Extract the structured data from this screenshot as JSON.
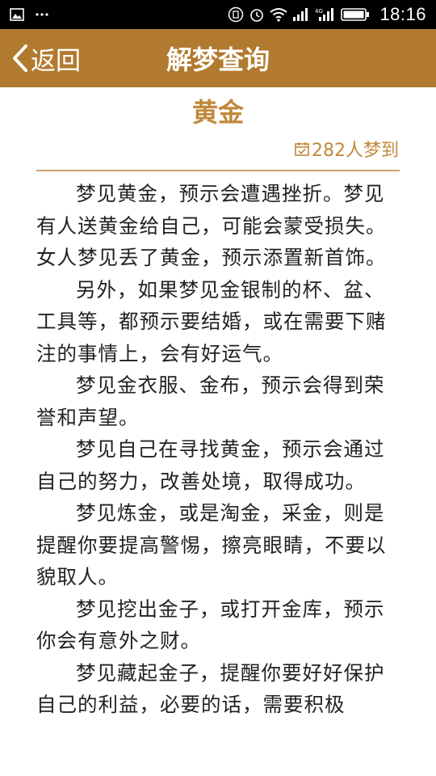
{
  "status_bar": {
    "time": "18:16",
    "left_icons": [
      "image-icon",
      "more-icon"
    ],
    "right_icons": [
      "vibrate-icon",
      "alarm-icon",
      "wifi-icon",
      "signal-icon",
      "4g-signal-icon",
      "battery-icon"
    ]
  },
  "header": {
    "back_label": "返回",
    "title": "解梦查询"
  },
  "dream": {
    "title": "黄金",
    "count_text": "282人梦到",
    "paragraphs": [
      "梦见黄金，预示会遭遇挫折。梦见有人送黄金给自己，可能会蒙受损失。女人梦见丢了黄金，预示添置新首饰。",
      "另外，如果梦见金银制的杯、盆、工具等，都预示要结婚，或在需要下赌注的事情上，会有好运气。",
      "梦见金衣服、金布，预示会得到荣誉和声望。",
      "梦见自己在寻找黄金，预示会通过自己的努力，改善处境，取得成功。",
      "梦见炼金，或是淘金，采金，则是提醒你要提高警惕，擦亮眼睛，不要以貌取人。",
      "梦见挖出金子，或打开金库，预示你会有意外之财。",
      "梦见藏起金子，提醒你要好好保护自己的利益，必要的话，需要积极"
    ]
  },
  "colors": {
    "header_bg": "#b27a2f",
    "accent": "#c0883a",
    "divider": "#c9a36a",
    "text": "#222222"
  }
}
